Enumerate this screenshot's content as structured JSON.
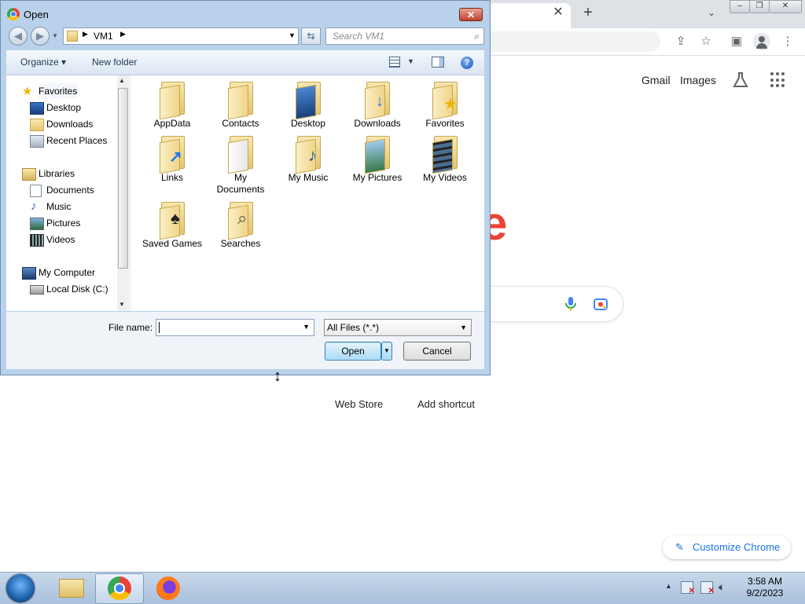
{
  "browser": {
    "header_links": [
      "Gmail",
      "Images"
    ],
    "logo_fragment": "e",
    "shortcuts": [
      "Web Store",
      "Add shortcut"
    ],
    "customize_label": "Customize Chrome",
    "icons": [
      "close-icon",
      "plus-icon",
      "chevron-down-icon",
      "share-icon",
      "star-icon",
      "side-panel-icon",
      "profile-icon",
      "more-vert-icon",
      "labs-icon",
      "apps-grid-icon",
      "mic-icon",
      "lens-icon",
      "pencil-icon"
    ]
  },
  "dialog": {
    "title": "Open",
    "breadcrumb": "VM1",
    "search_placeholder": "Search VM1",
    "organize_label": "Organize",
    "new_folder_label": "New folder",
    "nav": {
      "favorites_label": "Favorites",
      "favorites": [
        "Desktop",
        "Downloads",
        "Recent Places"
      ],
      "libraries_label": "Libraries",
      "libraries": [
        "Documents",
        "Music",
        "Pictures",
        "Videos"
      ],
      "computer_label": "My Computer",
      "computer": [
        "Local Disk (C:)"
      ]
    },
    "files": [
      "AppData",
      "Contacts",
      "Desktop",
      "Downloads",
      "Favorites",
      "Links",
      "My Documents",
      "My Music",
      "My Pictures",
      "My Videos",
      "Saved Games",
      "Searches"
    ],
    "filename_label": "File name:",
    "filename_value": "",
    "filetype_value": "All Files (*.*)",
    "open_label": "Open",
    "cancel_label": "Cancel"
  },
  "taskbar": {
    "time": "3:58 AM",
    "date": "9/2/2023"
  }
}
